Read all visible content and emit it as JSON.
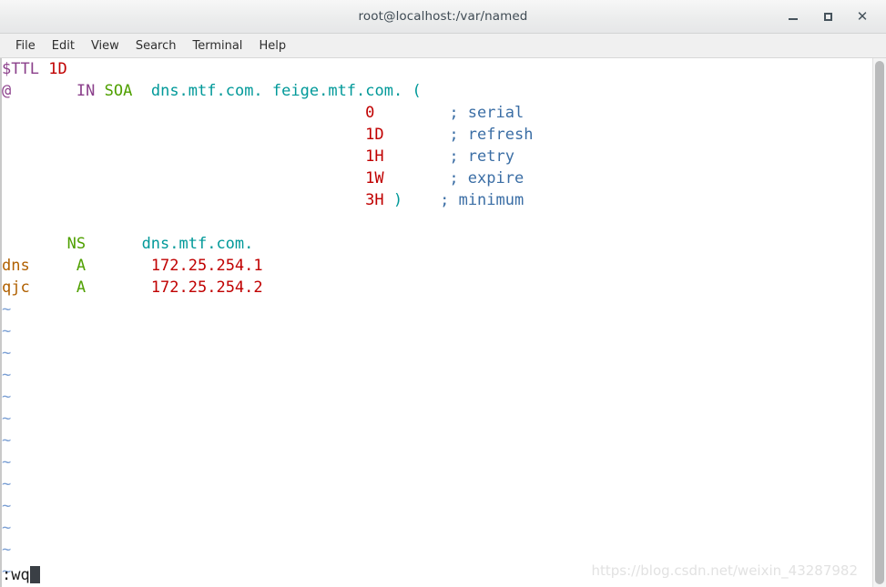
{
  "window": {
    "title": "root@localhost:/var/named",
    "controls": [
      {
        "name": "minimize-button",
        "label": "_"
      },
      {
        "name": "maximize-button",
        "label": "□"
      },
      {
        "name": "close-button",
        "label": "✕"
      }
    ]
  },
  "menubar": {
    "items": [
      "File",
      "Edit",
      "View",
      "Search",
      "Terminal",
      "Help"
    ]
  },
  "editor": {
    "application": "vim",
    "lines": [
      {
        "directive": "$TTL",
        "value": "1D"
      },
      {
        "owner": "@",
        "class": "IN",
        "type": "SOA",
        "primary": "dns.mtf.com.",
        "email": "feige.mtf.com.",
        "open_paren": "("
      },
      {
        "value": "0",
        "comment": "; serial"
      },
      {
        "value": "1D",
        "comment": "; refresh"
      },
      {
        "value": "1H",
        "comment": "; retry"
      },
      {
        "value": "1W",
        "comment": "; expire"
      },
      {
        "value": "3H",
        "close_paren": ")",
        "comment": "; minimum"
      },
      {
        "owner": "",
        "type": "NS",
        "target": "dns.mtf.com."
      },
      {
        "owner": "dns",
        "type": "A",
        "target": "172.25.254.1"
      },
      {
        "owner": "qjc",
        "type": "A",
        "target": "172.25.254.2"
      }
    ],
    "empty_line_marker": "~",
    "empty_line_count": 13,
    "command_line": ":wq",
    "cursor": "block"
  },
  "watermark": {
    "text": "https://blog.csdn.net/weixin_43287982"
  },
  "colors": {
    "directive": "#8b3f8b",
    "number": "#c00000",
    "record_type": "#4fa000",
    "domain": "#009999",
    "comment": "#3b6ea5",
    "owner": "#b06000",
    "tilde": "#7a9fd4",
    "background": "#ffffff",
    "titlebar": "#eceded"
  }
}
